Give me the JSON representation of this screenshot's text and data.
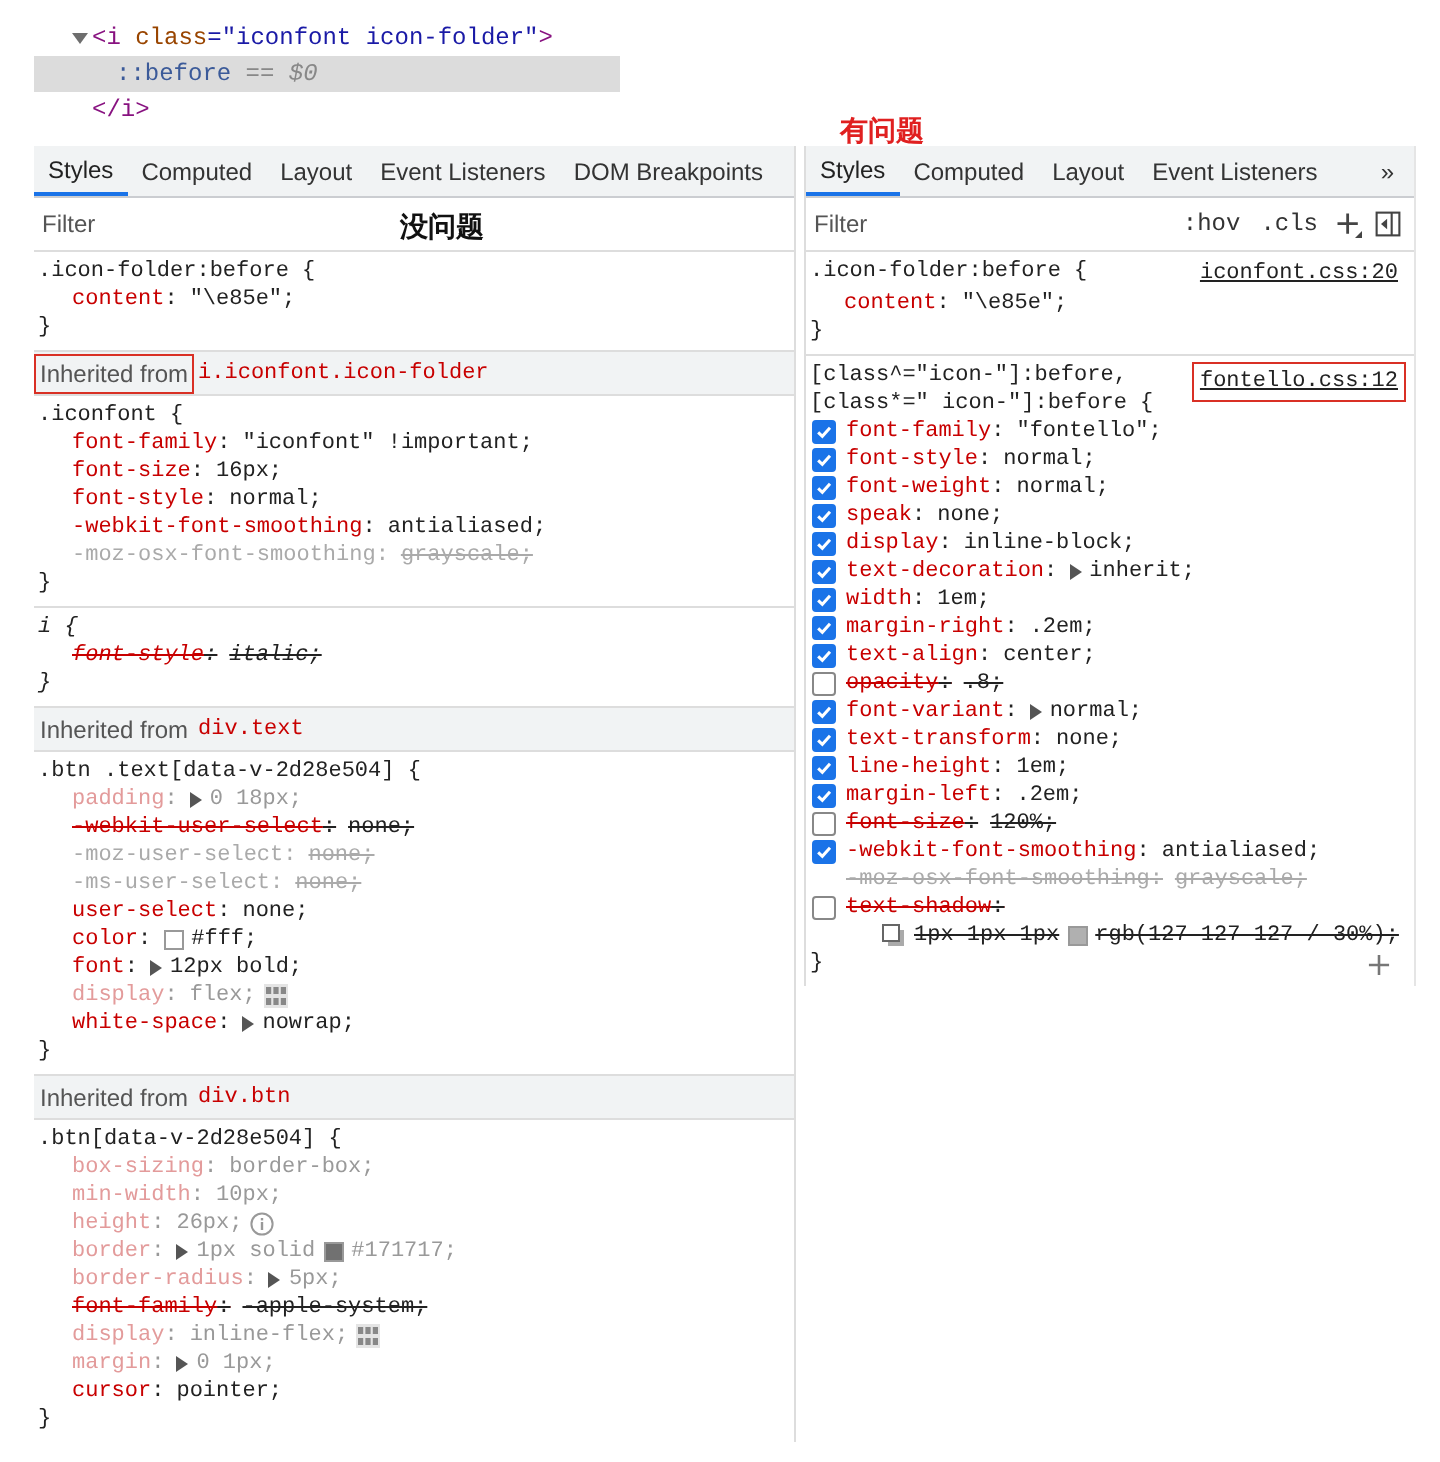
{
  "dom_tree": [
    {
      "parts": [
        {
          "text": "<i ",
          "kind": "tag"
        },
        {
          "text": "class",
          "kind": "attr"
        },
        {
          "text": "=\"iconfont icon-folder\"",
          "kind": "value"
        },
        {
          "text": ">",
          "kind": "tag"
        }
      ],
      "expanded": true,
      "selected": false,
      "children": [
        {
          "parts": [
            {
              "text": "::before",
              "kind": "pseudo"
            },
            {
              "text": " == $0",
              "kind": "note"
            }
          ],
          "selected": true
        }
      ]
    },
    {
      "parts": [
        {
          "text": "</i>",
          "kind": "tag"
        }
      ],
      "selected": false
    }
  ],
  "left_panel": {
    "annotation": {
      "text": "没问题",
      "kind": "filter"
    },
    "tabs": [
      {
        "label": "Styles",
        "selected": true
      },
      {
        "label": "Computed",
        "selected": false
      },
      {
        "label": "Layout",
        "selected": false
      },
      {
        "label": "Event Listeners",
        "selected": false
      },
      {
        "label": "DOM Breakpoints",
        "selected": false
      }
    ],
    "filter": {
      "placeholder": "Filter"
    },
    "sections": [
      {
        "kind": "rule",
        "selector": [
          ".icon-folder:before {"
        ],
        "close": "}",
        "properties": [
          {
            "name": "content:",
            "value": [
              {
                "text": "\"\\e85e\";"
              }
            ],
            "inactive": false,
            "overridden": false,
            "valid": true
          }
        ]
      },
      {
        "kind": "inherited",
        "label": "Inherited from",
        "element": "i.iconfont.icon-folder",
        "annotated": true
      },
      {
        "kind": "rule",
        "selector": [
          ".iconfont {"
        ],
        "close": "}",
        "properties": [
          {
            "name": "font-family:",
            "value": [
              {
                "text": "\"iconfont\" !important;"
              }
            ],
            "inactive": false,
            "overridden": false,
            "valid": true
          },
          {
            "name": "font-size:",
            "value": [
              {
                "text": "16px;"
              }
            ],
            "inactive": false,
            "overridden": false,
            "valid": true
          },
          {
            "name": "font-style:",
            "value": [
              {
                "text": "normal;"
              }
            ],
            "inactive": false,
            "overridden": false,
            "valid": true
          },
          {
            "name": "-webkit-font-smoothing:",
            "value": [
              {
                "text": "antialiased;"
              }
            ],
            "inactive": false,
            "overridden": false,
            "valid": true
          },
          {
            "name": "-moz-osx-font-smoothing:",
            "value": [
              {
                "text": "grayscale;"
              }
            ],
            "inactive": false,
            "overridden": false,
            "valid": false
          }
        ]
      },
      {
        "kind": "rule",
        "selector": [
          "i {"
        ],
        "close": "}",
        "italic": true,
        "properties": [
          {
            "name": "font-style:",
            "value": [
              {
                "text": "italic;"
              }
            ],
            "inactive": false,
            "overridden": true,
            "valid": true
          }
        ]
      },
      {
        "kind": "inherited",
        "label": "Inherited from",
        "element": "div.text",
        "annotated": false
      },
      {
        "kind": "rule",
        "selector": [
          ".btn .text[data-v-2d28e504] {"
        ],
        "close": "}",
        "properties": [
          {
            "name": "padding:",
            "value": [
              {
                "kind": "expander"
              },
              {
                "text": "0 18px;"
              }
            ],
            "inactive": true,
            "overridden": false,
            "valid": true
          },
          {
            "name": "-webkit-user-select:",
            "value": [
              {
                "text": "none;"
              }
            ],
            "inactive": false,
            "overridden": true,
            "valid": true
          },
          {
            "name": "-moz-user-select:",
            "value": [
              {
                "text": "none;"
              }
            ],
            "inactive": false,
            "overridden": false,
            "valid": false
          },
          {
            "name": "-ms-user-select:",
            "value": [
              {
                "text": "none;"
              }
            ],
            "inactive": false,
            "overridden": false,
            "valid": false
          },
          {
            "name": "user-select:",
            "value": [
              {
                "text": "none;"
              }
            ],
            "inactive": false,
            "overridden": false,
            "valid": true
          },
          {
            "name": "color:",
            "value": [
              {
                "kind": "swatch",
                "color": "#ffffff"
              },
              {
                "text": "#fff;"
              }
            ],
            "inactive": false,
            "overridden": false,
            "valid": true
          },
          {
            "name": "font:",
            "value": [
              {
                "kind": "expander"
              },
              {
                "text": "12px bold;"
              }
            ],
            "inactive": false,
            "overridden": false,
            "valid": true
          },
          {
            "name": "display:",
            "value": [
              {
                "text": "flex;"
              },
              {
                "kind": "grid"
              }
            ],
            "inactive": true,
            "overridden": false,
            "valid": true
          },
          {
            "name": "white-space:",
            "value": [
              {
                "kind": "expander"
              },
              {
                "text": "nowrap;"
              }
            ],
            "inactive": false,
            "overridden": false,
            "valid": true
          }
        ]
      },
      {
        "kind": "inherited",
        "label": "Inherited from",
        "element": "div.btn",
        "annotated": false
      },
      {
        "kind": "rule",
        "selector": [
          ".btn[data-v-2d28e504] {"
        ],
        "close": "}",
        "properties": [
          {
            "name": "box-sizing:",
            "value": [
              {
                "text": "border-box;"
              }
            ],
            "inactive": true,
            "overridden": false,
            "valid": true
          },
          {
            "name": "min-width:",
            "value": [
              {
                "text": "10px;"
              }
            ],
            "inactive": true,
            "overridden": false,
            "valid": true
          },
          {
            "name": "height:",
            "value": [
              {
                "text": "26px;"
              },
              {
                "kind": "info"
              }
            ],
            "inactive": true,
            "overridden": false,
            "valid": true
          },
          {
            "name": "border:",
            "value": [
              {
                "kind": "expander"
              },
              {
                "text": "1px solid"
              },
              {
                "kind": "swatch",
                "color": "#717171"
              },
              {
                "text": "#171717;"
              }
            ],
            "inactive": true,
            "overridden": false,
            "valid": true
          },
          {
            "name": "border-radius:",
            "value": [
              {
                "kind": "expander"
              },
              {
                "text": "5px;"
              }
            ],
            "inactive": true,
            "overridden": false,
            "valid": true
          },
          {
            "name": "font-family:",
            "value": [
              {
                "text": "-apple-system;"
              }
            ],
            "inactive": false,
            "overridden": true,
            "valid": true
          },
          {
            "name": "display:",
            "value": [
              {
                "text": "inline-flex;"
              },
              {
                "kind": "grid"
              }
            ],
            "inactive": true,
            "overridden": false,
            "valid": true
          },
          {
            "name": "margin:",
            "value": [
              {
                "kind": "expander"
              },
              {
                "text": "0 1px;"
              }
            ],
            "inactive": true,
            "overridden": false,
            "valid": true
          },
          {
            "name": "cursor:",
            "value": [
              {
                "text": "pointer;"
              }
            ],
            "inactive": false,
            "overridden": false,
            "valid": true
          }
        ]
      }
    ]
  },
  "right_panel": {
    "annotation": {
      "text": "有问题",
      "kind": "top"
    },
    "tabs": [
      {
        "label": "Styles",
        "selected": true
      },
      {
        "label": "Computed",
        "selected": false
      },
      {
        "label": "Layout",
        "selected": false
      },
      {
        "label": "Event Listeners",
        "selected": false
      }
    ],
    "overflow_label": "»",
    "filter": {
      "placeholder": "Filter"
    },
    "toolbar": [
      {
        "kind": "text",
        "label": ":hov"
      },
      {
        "kind": "text",
        "label": ".cls"
      },
      {
        "kind": "add"
      },
      {
        "kind": "sidebar"
      }
    ],
    "sections": [
      {
        "kind": "rule",
        "selector": [
          ".icon-folder:before {"
        ],
        "source": "iconfont.css:20",
        "source_annotated": false,
        "close": "}",
        "properties": [
          {
            "name": "content:",
            "value": [
              {
                "text": "\"\\e85e\";"
              }
            ],
            "inactive": false,
            "overridden": false,
            "valid": true
          }
        ]
      },
      {
        "kind": "rule",
        "selector": [
          "[class^=\"icon-\"]:before,",
          "[class*=\" icon-\"]:before {"
        ],
        "source": "fontello.css:12",
        "source_annotated": true,
        "close": "}",
        "add_button": true,
        "properties": [
          {
            "name": "font-family:",
            "value": [
              {
                "text": "\"fontello\";"
              }
            ],
            "inactive": false,
            "overridden": false,
            "valid": true,
            "checked": true
          },
          {
            "name": "font-style:",
            "value": [
              {
                "text": "normal;"
              }
            ],
            "inactive": false,
            "overridden": false,
            "valid": true,
            "checked": true
          },
          {
            "name": "font-weight:",
            "value": [
              {
                "text": "normal;"
              }
            ],
            "inactive": false,
            "overridden": false,
            "valid": true,
            "checked": true
          },
          {
            "name": "speak:",
            "value": [
              {
                "text": "none;"
              }
            ],
            "inactive": false,
            "overridden": false,
            "valid": true,
            "checked": true
          },
          {
            "name": "display:",
            "value": [
              {
                "text": "inline-block;"
              }
            ],
            "inactive": false,
            "overridden": false,
            "valid": true,
            "checked": true
          },
          {
            "name": "text-decoration:",
            "value": [
              {
                "kind": "expander"
              },
              {
                "text": "inherit;"
              }
            ],
            "inactive": false,
            "overridden": false,
            "valid": true,
            "checked": true
          },
          {
            "name": "width:",
            "value": [
              {
                "text": "1em;"
              }
            ],
            "inactive": false,
            "overridden": false,
            "valid": true,
            "checked": true
          },
          {
            "name": "margin-right:",
            "value": [
              {
                "text": ".2em;"
              }
            ],
            "inactive": false,
            "overridden": false,
            "valid": true,
            "checked": true
          },
          {
            "name": "text-align:",
            "value": [
              {
                "text": "center;"
              }
            ],
            "inactive": false,
            "overridden": false,
            "valid": true,
            "checked": true
          },
          {
            "name": "opacity:",
            "value": [
              {
                "text": ".8;"
              }
            ],
            "inactive": false,
            "overridden": true,
            "valid": true,
            "checked": false
          },
          {
            "name": "font-variant:",
            "value": [
              {
                "kind": "expander"
              },
              {
                "text": "normal;"
              }
            ],
            "inactive": false,
            "overridden": false,
            "valid": true,
            "checked": true
          },
          {
            "name": "text-transform:",
            "value": [
              {
                "text": "none;"
              }
            ],
            "inactive": false,
            "overridden": false,
            "valid": true,
            "checked": true
          },
          {
            "name": "line-height:",
            "value": [
              {
                "text": "1em;"
              }
            ],
            "inactive": false,
            "overridden": false,
            "valid": true,
            "checked": true
          },
          {
            "name": "margin-left:",
            "value": [
              {
                "text": ".2em;"
              }
            ],
            "inactive": false,
            "overridden": false,
            "valid": true,
            "checked": true
          },
          {
            "name": "font-size:",
            "value": [
              {
                "text": "120%;"
              }
            ],
            "inactive": false,
            "overridden": true,
            "valid": true,
            "checked": false
          },
          {
            "name": "-webkit-font-smoothing:",
            "value": [
              {
                "text": "antialiased;"
              }
            ],
            "inactive": false,
            "overridden": false,
            "valid": true,
            "checked": true
          },
          {
            "name": "-moz-osx-font-smoothing:",
            "value": [
              {
                "text": "grayscale;"
              }
            ],
            "inactive": false,
            "overridden": true,
            "valid": false
          },
          {
            "name": "text-shadow:",
            "value": [
              {
                "kind": "shadow"
              },
              {
                "text": "1px 1px 1px"
              },
              {
                "kind": "swatch",
                "color": "#b0b0b0"
              },
              {
                "text": "rgb(127 127 127 / 30%);"
              }
            ],
            "inactive": false,
            "overridden": true,
            "valid": true,
            "checked": false,
            "wrap": true
          }
        ]
      }
    ]
  }
}
